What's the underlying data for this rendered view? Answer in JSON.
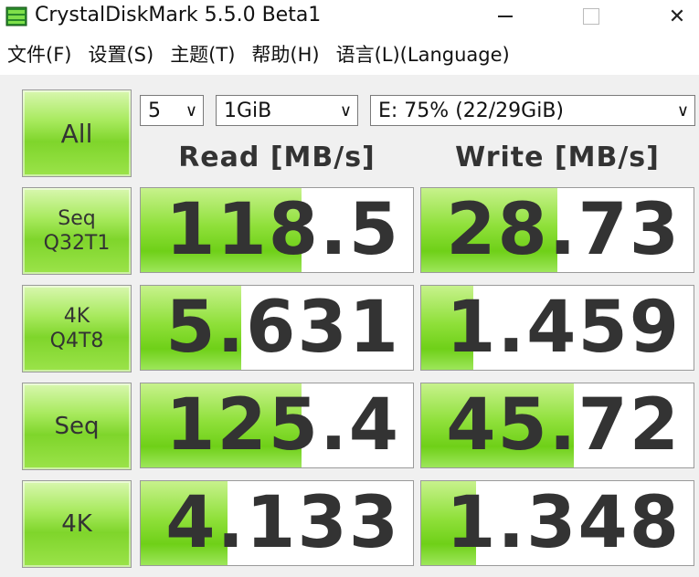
{
  "window": {
    "title": "CrystalDiskMark 5.5.0 Beta1",
    "minimize_icon": "minimize-icon",
    "maximize_icon": "maximize-icon",
    "close_icon": "close-icon",
    "close_glyph": "✕"
  },
  "menu": [
    "文件(F)",
    "设置(S)",
    "主题(T)",
    "帮助(H)",
    "语言(L)(Language)"
  ],
  "controls": {
    "all_label": "All",
    "count": "5",
    "size": "1GiB",
    "drive": "E: 75% (22/29GiB)",
    "chevron": "∨"
  },
  "headers": {
    "read": "Read [MB/s]",
    "write": "Write [MB/s]"
  },
  "tests": [
    {
      "label_line1": "Seq",
      "label_line2": "Q32T1",
      "read": "118.5",
      "write": "28.73",
      "read_fill": 0.59,
      "write_fill": 0.5
    },
    {
      "label_line1": "4K",
      "label_line2": "Q4T8",
      "read": "5.631",
      "write": "1.459",
      "read_fill": 0.37,
      "write_fill": 0.19
    },
    {
      "label_line1": "Seq",
      "label_line2": "",
      "read": "125.4",
      "write": "45.72",
      "read_fill": 0.59,
      "write_fill": 0.56
    },
    {
      "label_line1": "4K",
      "label_line2": "",
      "read": "4.133",
      "write": "1.348",
      "read_fill": 0.32,
      "write_fill": 0.2
    }
  ],
  "colors": {
    "accent_green": "#7fd52b",
    "bar_green": "#8fe03a"
  }
}
